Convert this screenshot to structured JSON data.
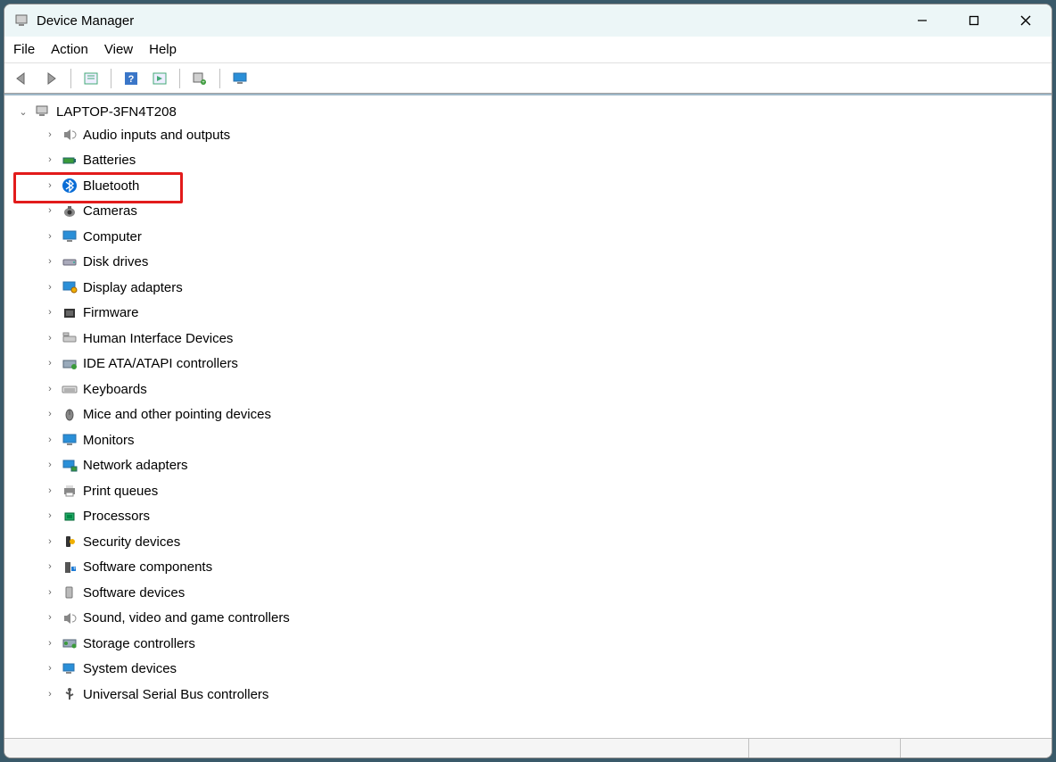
{
  "window": {
    "title": "Device Manager"
  },
  "menu": {
    "file": "File",
    "action": "Action",
    "view": "View",
    "help": "Help"
  },
  "root": {
    "name": "LAPTOP-3FN4T208"
  },
  "categories": [
    {
      "label": "Audio inputs and outputs",
      "icon": "speaker"
    },
    {
      "label": "Batteries",
      "icon": "battery"
    },
    {
      "label": "Bluetooth",
      "icon": "bluetooth",
      "highlighted": true
    },
    {
      "label": "Cameras",
      "icon": "camera"
    },
    {
      "label": "Computer",
      "icon": "computer"
    },
    {
      "label": "Disk drives",
      "icon": "disk"
    },
    {
      "label": "Display adapters",
      "icon": "display"
    },
    {
      "label": "Firmware",
      "icon": "firmware"
    },
    {
      "label": "Human Interface Devices",
      "icon": "hid"
    },
    {
      "label": "IDE ATA/ATAPI controllers",
      "icon": "ide"
    },
    {
      "label": "Keyboards",
      "icon": "keyboard"
    },
    {
      "label": "Mice and other pointing devices",
      "icon": "mouse"
    },
    {
      "label": "Monitors",
      "icon": "monitor"
    },
    {
      "label": "Network adapters",
      "icon": "network"
    },
    {
      "label": "Print queues",
      "icon": "printer"
    },
    {
      "label": "Processors",
      "icon": "cpu"
    },
    {
      "label": "Security devices",
      "icon": "security"
    },
    {
      "label": "Software components",
      "icon": "swcomp"
    },
    {
      "label": "Software devices",
      "icon": "swdev"
    },
    {
      "label": "Sound, video and game controllers",
      "icon": "sound"
    },
    {
      "label": "Storage controllers",
      "icon": "storage"
    },
    {
      "label": "System devices",
      "icon": "system"
    },
    {
      "label": "Universal Serial Bus controllers",
      "icon": "usb"
    }
  ]
}
